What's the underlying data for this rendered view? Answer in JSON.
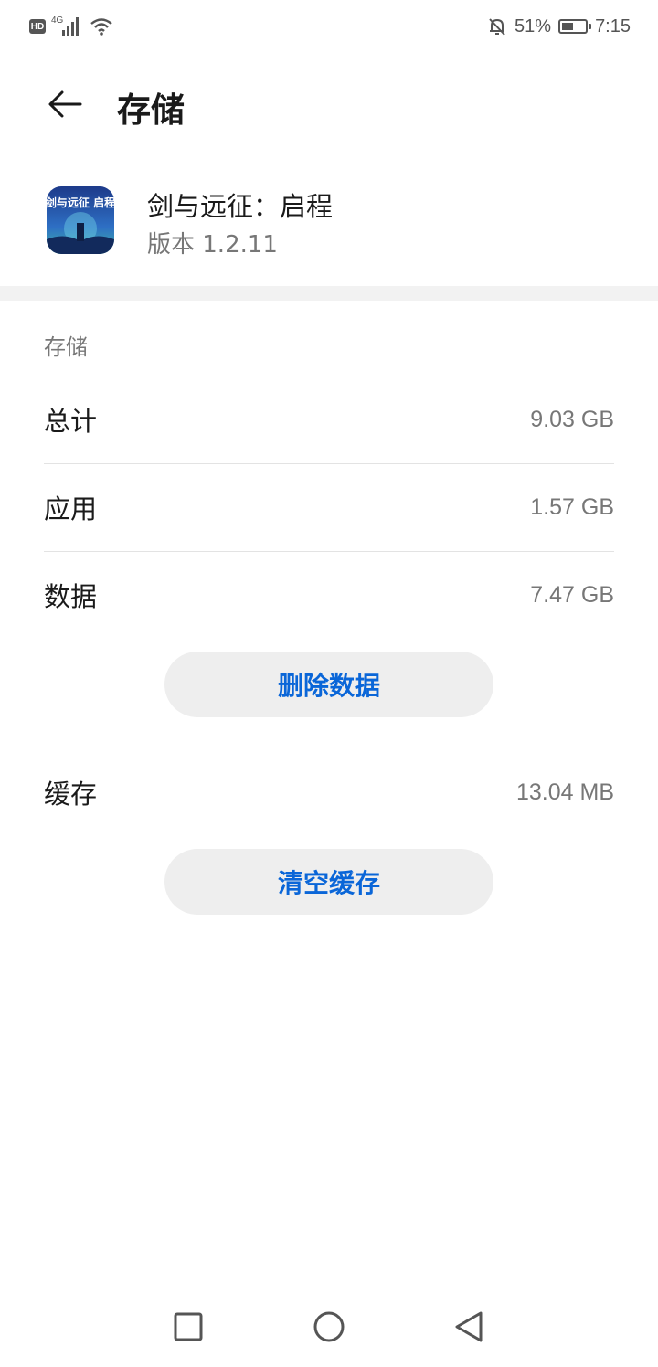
{
  "status_bar": {
    "hd_badge": "HD",
    "network_type": "4G",
    "battery_percent": "51%",
    "battery_level": 0.51,
    "time": "7:15",
    "icons": [
      "hd-icon",
      "signal-icon",
      "wifi-icon",
      "mute-bell-icon",
      "battery-icon"
    ]
  },
  "header": {
    "title": "存储"
  },
  "app": {
    "name": "剑与远征：启程",
    "version": "版本 1.2.11",
    "icon_text": "剑与远征 启程",
    "icon_colors": [
      "#1d3a8a",
      "#2e6fc4",
      "#3fb6a8"
    ]
  },
  "storage": {
    "section_label": "存储",
    "rows": [
      {
        "label": "总计",
        "value": "9.03 GB"
      },
      {
        "label": "应用",
        "value": "1.57 GB"
      },
      {
        "label": "数据",
        "value": "7.47 GB"
      }
    ],
    "delete_data_button": "删除数据",
    "cache": {
      "label": "缓存",
      "value": "13.04 MB"
    },
    "clear_cache_button": "清空缓存"
  },
  "colors": {
    "accent": "#0a66d8",
    "pill_bg": "#eeeeee",
    "band": "#f2f2f2"
  },
  "nav_bar": {
    "icons": [
      "recent-apps-icon",
      "home-icon",
      "back-nav-icon"
    ]
  }
}
